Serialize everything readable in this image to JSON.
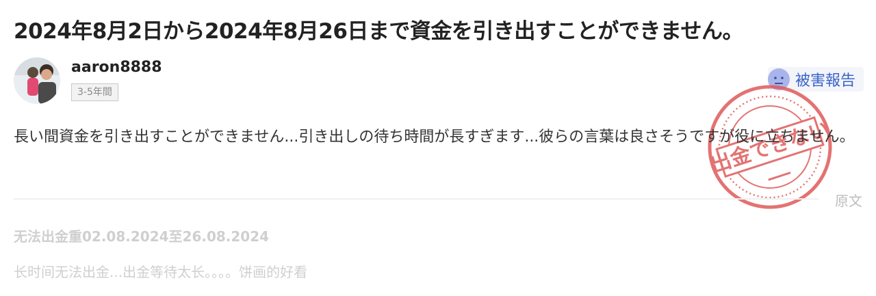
{
  "review": {
    "title": "2024年8月2日から2024年8月26日まで資金を引き出すことができません。",
    "author": "aaron8888",
    "tenure_badge": "3-5年間",
    "report_label": "被害報告",
    "stamp_text": "出金できない",
    "body": "長い間資金を引き出すことができません...引き出しの待ち時間が長すぎます...彼らの言葉は良さそうですが役に立ちません。",
    "original_link": "原文",
    "original_title": "无法出金重02.08.2024至26.08.2024",
    "original_body": "长时间无法出金...出金等待太长。。。。饼画的好看"
  },
  "colors": {
    "report_text": "#3b63c7",
    "stamp_red": "#e05a5a",
    "muted_text": "#cfcfcf"
  }
}
